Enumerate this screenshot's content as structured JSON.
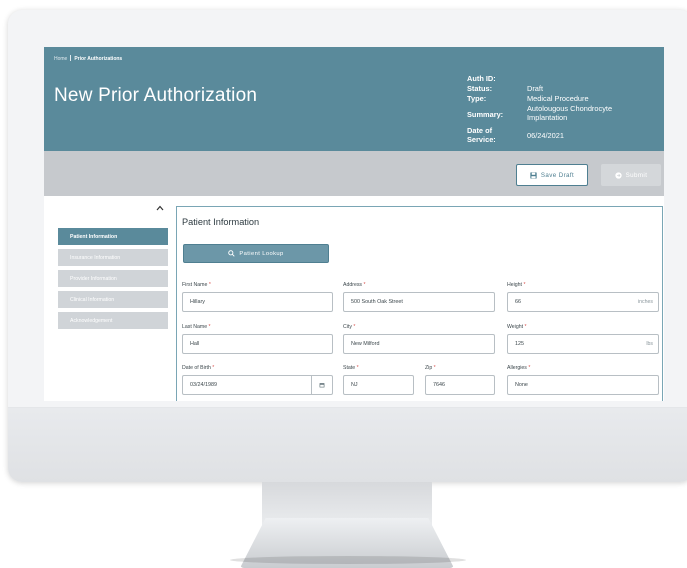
{
  "breadcrumb": {
    "home": "Home",
    "current": "Prior Authorizations"
  },
  "page_title": "New Prior Authorization",
  "auth_meta": [
    {
      "label": "Auth ID:",
      "value": ""
    },
    {
      "label": "Status:",
      "value": "Draft"
    },
    {
      "label": "Type:",
      "value": "Medical Procedure"
    },
    {
      "label": "Summary:",
      "value": "Autolougous Chondrocyte Implantation"
    },
    {
      "label": "Date of Service:",
      "value": "06/24/2021"
    }
  ],
  "toolbar": {
    "save_label": "Save Draft",
    "submit_label": "Submit"
  },
  "sidebar": {
    "items": [
      {
        "label": "Patient Information",
        "active": true
      },
      {
        "label": "Insurance Information",
        "active": false
      },
      {
        "label": "Provider Information",
        "active": false
      },
      {
        "label": "Clinical Information",
        "active": false
      },
      {
        "label": "Acknowledgement",
        "active": false
      }
    ]
  },
  "form": {
    "section_title": "Patient Information",
    "lookup_label": "Patient Lookup",
    "fields": {
      "first_name": {
        "label": "First Name",
        "value": "Hillary"
      },
      "address": {
        "label": "Address",
        "value": "500 South Oak Street"
      },
      "height": {
        "label": "Height",
        "value": "66",
        "unit": "inches"
      },
      "last_name": {
        "label": "Last Name",
        "value": "Hall"
      },
      "city": {
        "label": "City",
        "value": "New Milford"
      },
      "weight": {
        "label": "Weight",
        "value": "125",
        "unit": "lbs"
      },
      "dob": {
        "label": "Date of Birth",
        "value": "03/24/1989"
      },
      "state": {
        "label": "State",
        "value": "NJ"
      },
      "zip": {
        "label": "Zip",
        "value": "7646"
      },
      "allergies": {
        "label": "Allergies",
        "value": "None"
      }
    },
    "required_mark": "*"
  },
  "colors": {
    "header": "#5a8a9b",
    "accent": "#4f7f91",
    "toolbar": "#c6c9cd",
    "required": "#d9534f"
  }
}
